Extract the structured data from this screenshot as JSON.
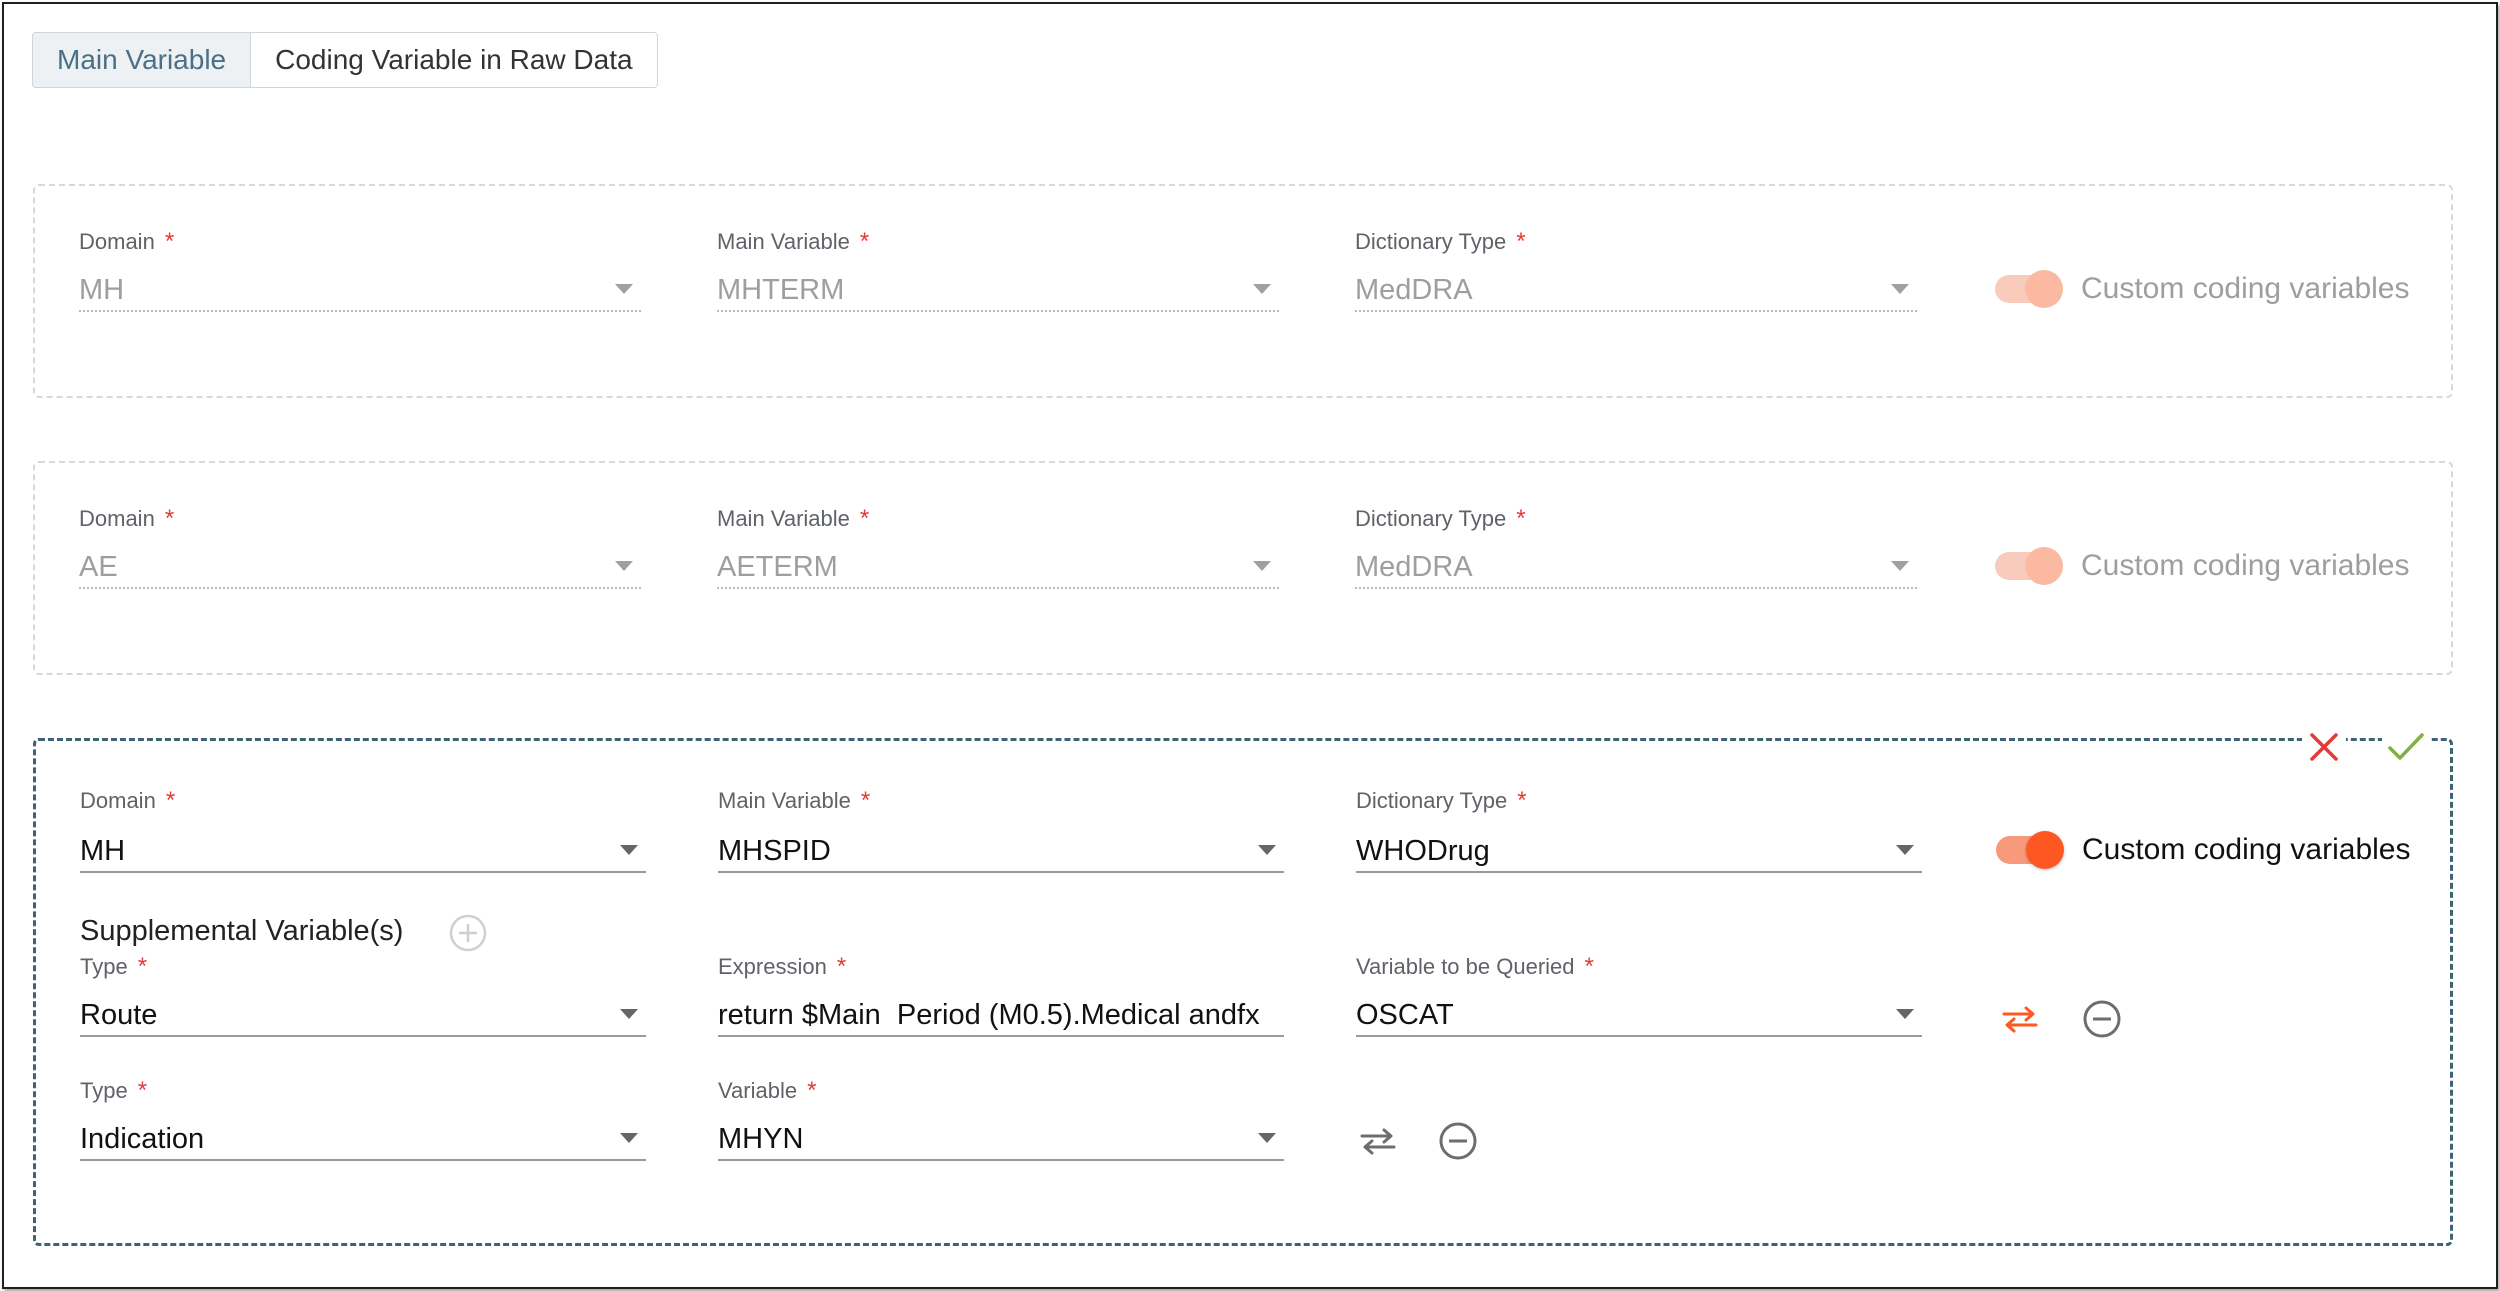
{
  "tabs": [
    {
      "label": "Main Variable",
      "active": true
    },
    {
      "label": "Coding Variable in Raw Data",
      "active": false
    }
  ],
  "cards": [
    {
      "state": "disabled",
      "domain": {
        "label": "Domain",
        "value": "MH"
      },
      "main_variable": {
        "label": "Main Variable",
        "value": "MHTERM"
      },
      "dictionary_type": {
        "label": "Dictionary Type",
        "value": "MedDRA"
      },
      "toggle": {
        "label": "Custom coding variables",
        "on": true
      }
    },
    {
      "state": "disabled",
      "domain": {
        "label": "Domain",
        "value": "AE"
      },
      "main_variable": {
        "label": "Main Variable",
        "value": "AETERM"
      },
      "dictionary_type": {
        "label": "Dictionary Type",
        "value": "MedDRA"
      },
      "toggle": {
        "label": "Custom coding variables",
        "on": true
      }
    },
    {
      "state": "editing",
      "domain": {
        "label": "Domain",
        "value": "MH"
      },
      "main_variable": {
        "label": "Main Variable",
        "value": "MHSPID"
      },
      "dictionary_type": {
        "label": "Dictionary Type",
        "value": "WHODrug"
      },
      "toggle": {
        "label": "Custom coding variables",
        "on": true
      },
      "supplemental_title": "Supplemental Variable(s)",
      "rows": [
        {
          "type": {
            "label": "Type",
            "value": "Route"
          },
          "expression": {
            "label": "Expression",
            "value": "return $Main  Period (M0.5).Medical andfx"
          },
          "queried": {
            "label": "Variable to be Queried",
            "value": "OSCAT"
          }
        },
        {
          "type": {
            "label": "Type",
            "value": "Indication"
          },
          "variable": {
            "label": "Variable",
            "value": "MHYN"
          }
        }
      ]
    }
  ],
  "required_mark": "*",
  "colors": {
    "accent": "#ff5722",
    "cancel": "#e53935",
    "confirm": "#7cb342",
    "active_border": "#3d6475",
    "tab_active_text": "#4a6f86"
  },
  "icons": [
    "close-icon",
    "check-icon",
    "add-circle-icon",
    "swap-icon",
    "remove-circle-icon"
  ]
}
